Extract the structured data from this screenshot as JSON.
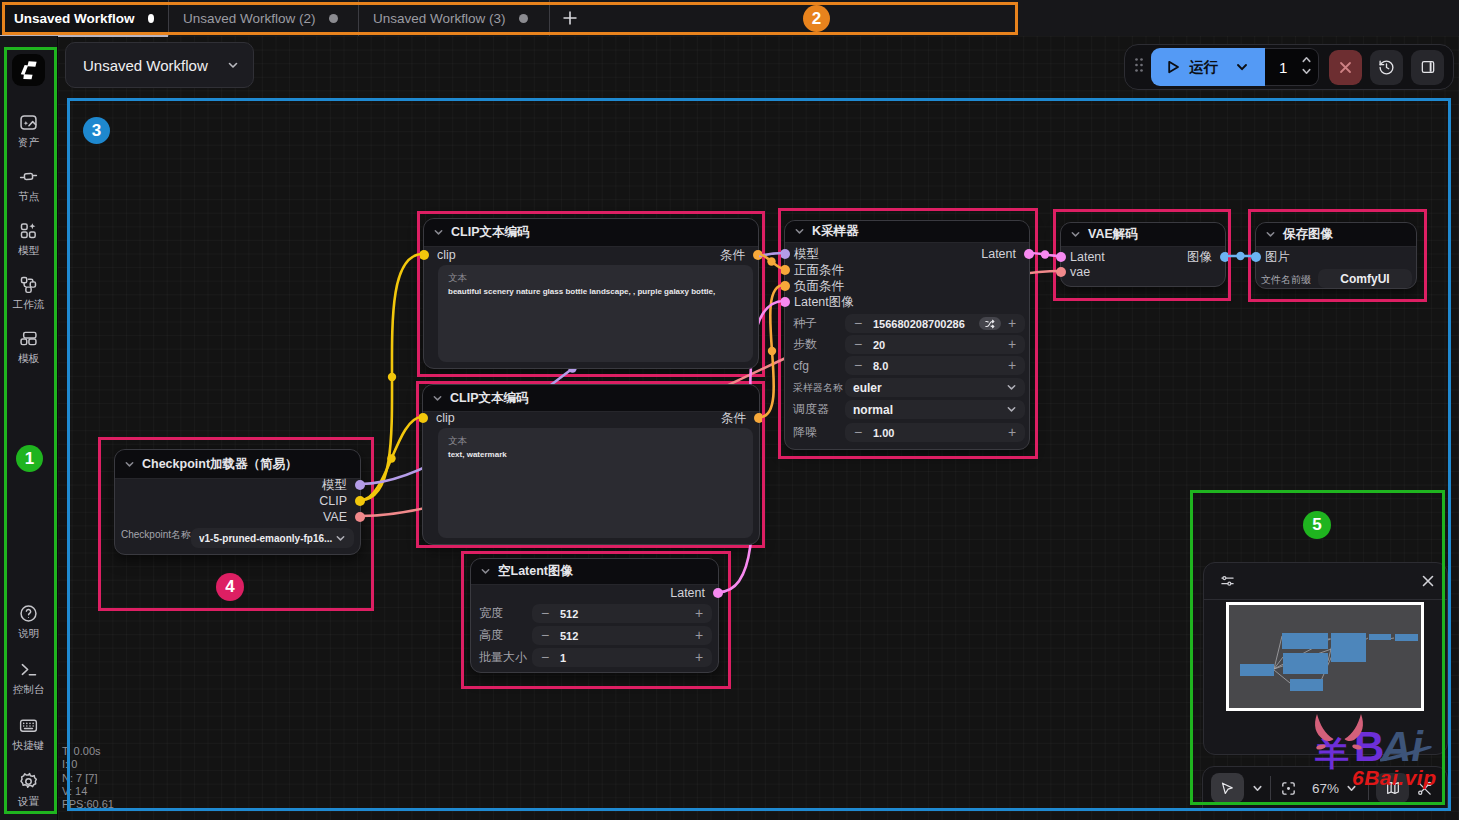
{
  "tabs": {
    "items": [
      {
        "label": "Unsaved Workflow",
        "active": true
      },
      {
        "label": "Unsaved Workflow (2)",
        "active": false
      },
      {
        "label": "Unsaved Workflow (3)",
        "active": false
      }
    ]
  },
  "workflow_menu": {
    "label": "Unsaved Workflow"
  },
  "sidebar": {
    "top_items": [
      {
        "label": "资产"
      },
      {
        "label": "节点"
      },
      {
        "label": "模型"
      },
      {
        "label": "工作流"
      },
      {
        "label": "模板"
      }
    ],
    "bottom_items": [
      {
        "label": "说明"
      },
      {
        "label": "控制台"
      },
      {
        "label": "快捷键"
      },
      {
        "label": "设置"
      }
    ]
  },
  "toolbar": {
    "run_label": "运行",
    "batch_count": "1"
  },
  "colors": {
    "model": "#b49ce8",
    "clip": "#f2c70c",
    "vae": "#f1898b",
    "conditioning": "#f7a83a",
    "latent": "#f78af0",
    "image": "#6cb3f2",
    "run_button": "#549af5",
    "annotation_green": "#1fb41f",
    "annotation_orange": "#e8831d",
    "annotation_blue": "#1f8ad2",
    "annotation_pink": "#dd1f63"
  },
  "nodes": {
    "checkpoint": {
      "title": "Checkpoint加载器（简易）",
      "outputs": [
        {
          "label": "模型"
        },
        {
          "label": "CLIP"
        },
        {
          "label": "VAE"
        }
      ],
      "widget": {
        "label": "Checkpoint名称",
        "value": "v1-5-pruned-emaonly-fp16..."
      }
    },
    "clip1": {
      "title": "CLIP文本编码",
      "input": {
        "label": "clip"
      },
      "output": {
        "label": "条件"
      },
      "widget": {
        "label": "文本",
        "value": "beautiful scenery nature glass bottle landscape, , purple galaxy bottle,"
      }
    },
    "clip2": {
      "title": "CLIP文本编码",
      "input": {
        "label": "clip"
      },
      "output": {
        "label": "条件"
      },
      "widget": {
        "label": "文本",
        "value": "text, watermark"
      }
    },
    "ksampler": {
      "title": "K采样器",
      "inputs": [
        {
          "label": "模型"
        },
        {
          "label": "正面条件"
        },
        {
          "label": "负面条件"
        },
        {
          "label": "Latent图像"
        }
      ],
      "output": {
        "label": "Latent"
      },
      "widgets": [
        {
          "label": "种子",
          "value": "156680208700286",
          "type": "seed"
        },
        {
          "label": "步数",
          "value": "20",
          "type": "num"
        },
        {
          "label": "cfg",
          "value": "8.0",
          "type": "num"
        },
        {
          "label": "采样器名称",
          "value": "euler",
          "type": "combo"
        },
        {
          "label": "调度器",
          "value": "normal",
          "type": "combo"
        },
        {
          "label": "降噪",
          "value": "1.00",
          "type": "num"
        }
      ]
    },
    "vaedecode": {
      "title": "VAE解码",
      "inputs": [
        {
          "label": "Latent"
        },
        {
          "label": "vae"
        }
      ],
      "output": {
        "label": "图像"
      }
    },
    "saveimage": {
      "title": "保存图像",
      "input": {
        "label": "图片"
      },
      "widget": {
        "label": "文件名前缀",
        "value": "ComfyUI"
      }
    },
    "emptylatent": {
      "title": "空Latent图像",
      "output": {
        "label": "Latent"
      },
      "widgets": [
        {
          "label": "宽度",
          "value": "512"
        },
        {
          "label": "高度",
          "value": "512"
        },
        {
          "label": "批量大小",
          "value": "1"
        }
      ]
    }
  },
  "stats": {
    "lines": [
      "T: 0.00s",
      "I: 0",
      "N: 7 [7]",
      "V: 14",
      "FPS:60.61"
    ]
  },
  "minimap": {
    "zoom_level": "67%"
  },
  "watermark": {
    "char": "羊",
    "b": "B",
    "ai": "Ai",
    "site": "6Bai.vip"
  },
  "annotations": {
    "badges": [
      "1",
      "2",
      "3",
      "4",
      "5"
    ]
  }
}
